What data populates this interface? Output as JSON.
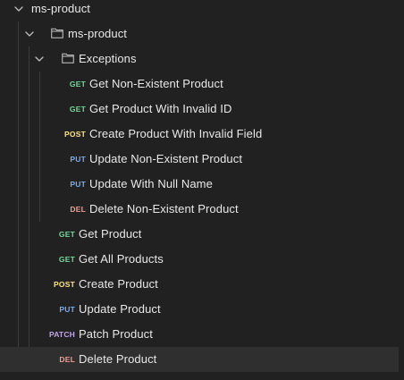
{
  "collection": {
    "name": "ms-product",
    "folder": {
      "name": "ms-product",
      "subfolder": {
        "name": "Exceptions",
        "requests": [
          {
            "method": "GET",
            "name": "Get Non-Existent Product"
          },
          {
            "method": "GET",
            "name": "Get Product With Invalid ID"
          },
          {
            "method": "POST",
            "name": "Create Product With Invalid Field"
          },
          {
            "method": "PUT",
            "name": "Update Non-Existent Product"
          },
          {
            "method": "PUT",
            "name": "Update With Null Name"
          },
          {
            "method": "DEL",
            "name": "Delete Non-Existent Product"
          }
        ]
      },
      "requests": [
        {
          "method": "GET",
          "name": "Get Product"
        },
        {
          "method": "GET",
          "name": "Get All Products"
        },
        {
          "method": "POST",
          "name": "Create Product"
        },
        {
          "method": "PUT",
          "name": "Update Product"
        },
        {
          "method": "PATCH",
          "name": "Patch Product"
        },
        {
          "method": "DEL",
          "name": "Delete Product"
        }
      ]
    }
  },
  "icons": {
    "collapse": "chevron-down-icon",
    "folder": "folder-icon"
  },
  "colors": {
    "background": "#212121",
    "selected_row": "#2f2f2f",
    "get": "#6bdd9a",
    "post": "#ffe47e",
    "put": "#74aef6",
    "del": "#f79a8e",
    "patch": "#c0a8e1"
  }
}
